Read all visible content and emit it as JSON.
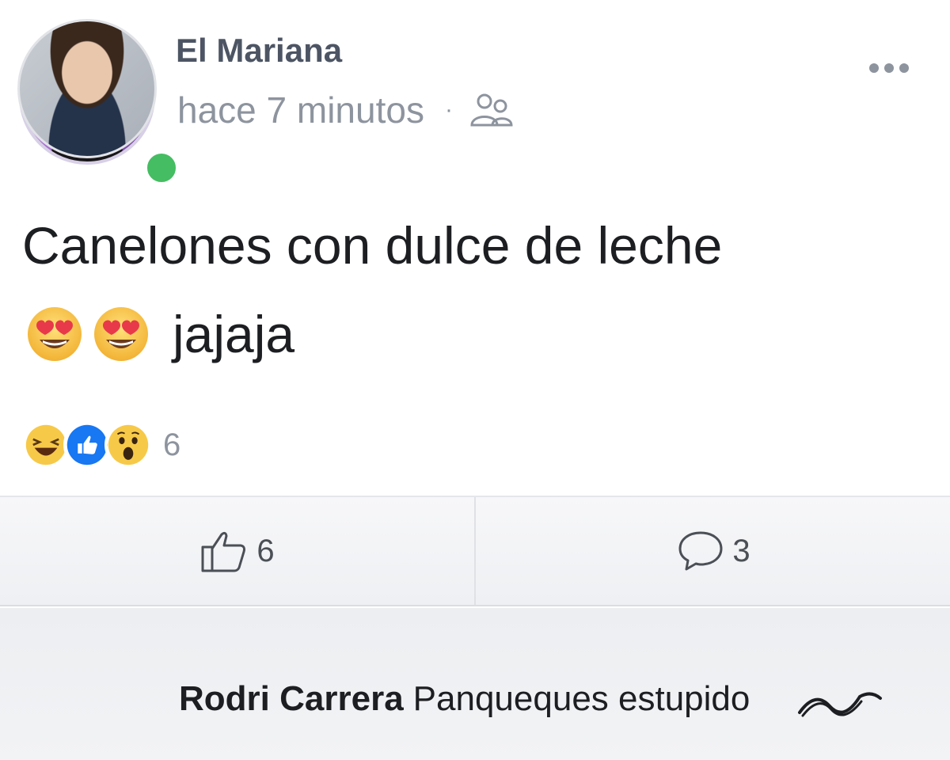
{
  "post": {
    "author": "El Mariana",
    "time": "hace 7 minutos",
    "separator": "·",
    "audience_icon": "friends-icon",
    "more_icon": "more-options-icon",
    "text_line1": "Canelones con dulce de leche",
    "text_line2_suffix": "jajaja",
    "text_emojis": [
      "heart-eyes-emoji",
      "heart-eyes-emoji"
    ]
  },
  "reactions": {
    "icons": [
      "haha-reaction-icon",
      "like-reaction-icon",
      "wow-reaction-icon"
    ],
    "count": "6"
  },
  "actions": {
    "like_count": "6",
    "comment_count": "3"
  },
  "comment": {
    "author": "Rodri Carrera",
    "text": "Panqueques estupido"
  },
  "colors": {
    "online": "#45bd62",
    "like_blue": "#1877f2",
    "muted_text": "#8d949e",
    "author_text": "#4d5564"
  }
}
